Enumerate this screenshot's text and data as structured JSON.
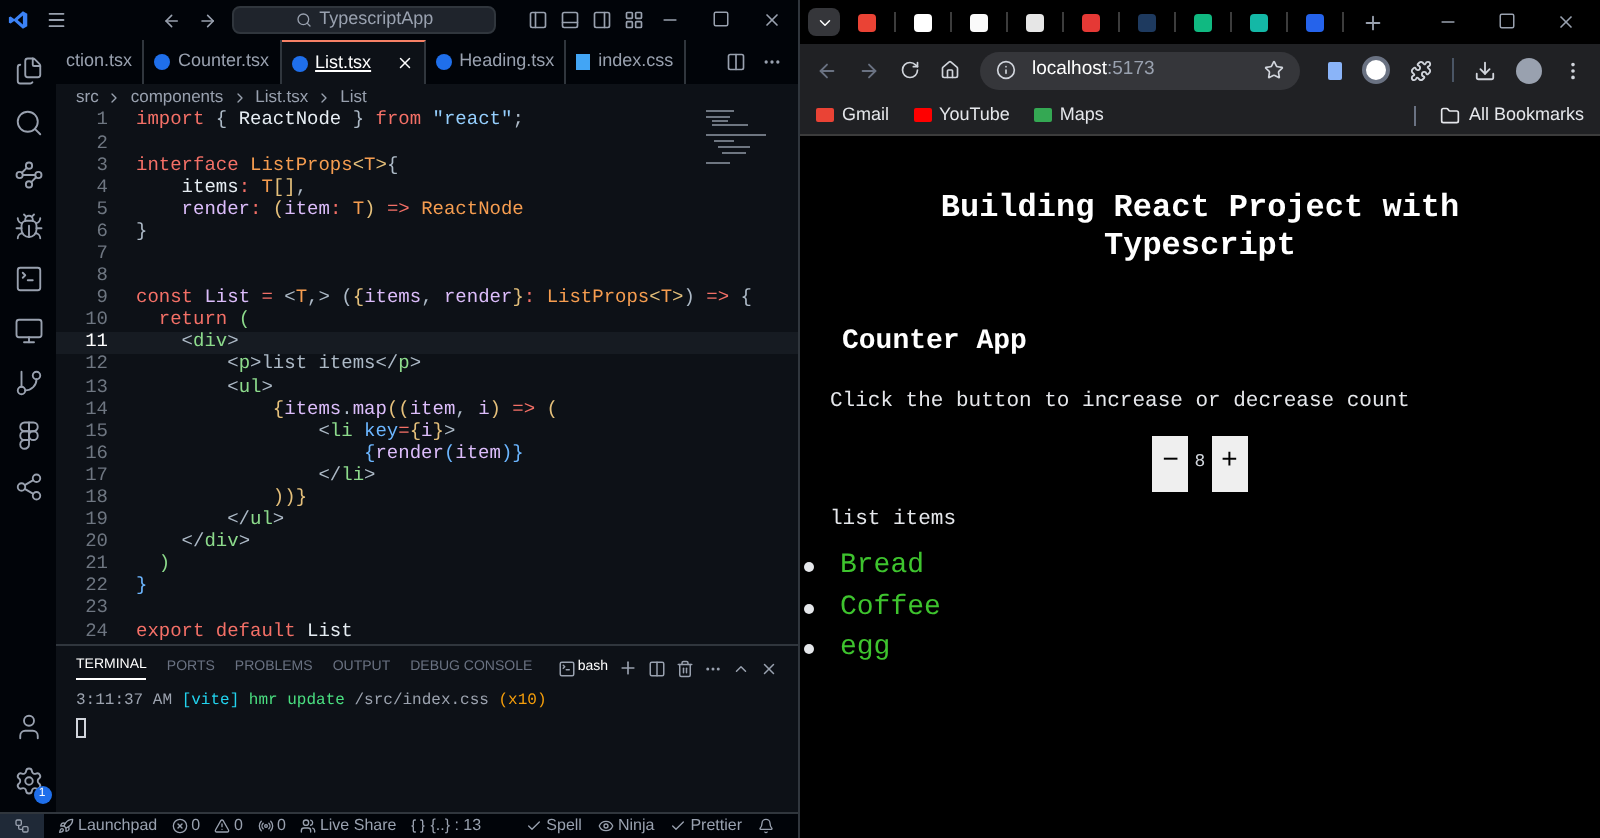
{
  "editor": {
    "title_bar": {
      "search": "TypescriptApp"
    },
    "activity_bar": [
      {
        "kind": "files"
      },
      {
        "kind": "search"
      },
      {
        "kind": "source-control"
      },
      {
        "kind": "debug"
      },
      {
        "kind": "remote"
      },
      {
        "kind": "monitor"
      },
      {
        "kind": "graph"
      },
      {
        "kind": "figma"
      },
      {
        "kind": "share"
      }
    ],
    "account": {
      "badge": "1"
    },
    "tabs": [
      {
        "label": "ction.tsx",
        "selected": false,
        "kind": "react"
      },
      {
        "label": "Counter.tsx",
        "selected": false,
        "kind": "react"
      },
      {
        "label": "List.tsx",
        "selected": true,
        "kind": "react"
      },
      {
        "label": "Heading.tsx",
        "selected": false,
        "kind": "react"
      },
      {
        "label": "index.css",
        "selected": false,
        "kind": "css"
      }
    ],
    "breadcrumb": [
      "src",
      "components",
      "List.tsx",
      "List"
    ],
    "code": [
      {
        "number": "1",
        "selected": false,
        "tokens": [
          {
            "text": "import",
            "kind": "kw"
          },
          {
            "text": " { ",
            "kind": "p"
          },
          {
            "text": "ReactNode",
            "kind": "id"
          },
          {
            "text": " } ",
            "kind": "p"
          },
          {
            "text": "from ",
            "kind": "kw"
          },
          {
            "text": "\"react\"",
            "kind": "str"
          },
          {
            "text": ";",
            "kind": "p"
          }
        ]
      },
      {
        "number": "2",
        "selected": false
      },
      {
        "number": "3",
        "selected": false,
        "tokens": [
          {
            "text": "interface ",
            "kind": "kw"
          },
          {
            "text": "ListProps",
            "kind": "type"
          },
          {
            "text": "<",
            "kind": "br"
          },
          {
            "text": "T",
            "kind": "type"
          },
          {
            "text": ">",
            "kind": "br"
          },
          {
            "text": "{",
            "kind": "p"
          }
        ]
      },
      {
        "number": "4",
        "selected": false,
        "tokens": [
          {
            "text": "    items",
            "kind": "id"
          },
          {
            "text": ": ",
            "kind": "kw"
          },
          {
            "text": "T",
            "kind": "type"
          },
          {
            "text": "[]",
            "kind": "br"
          },
          {
            "text": ",",
            "kind": "p"
          }
        ]
      },
      {
        "number": "5",
        "selected": false,
        "tokens": [
          {
            "text": "    render",
            "kind": "param"
          },
          {
            "text": ": ",
            "kind": "kw"
          },
          {
            "text": "(",
            "kind": "br"
          },
          {
            "text": "item",
            "kind": "param"
          },
          {
            "text": ": ",
            "kind": "kw"
          },
          {
            "text": "T",
            "kind": "type"
          },
          {
            "text": ")",
            "kind": "br"
          },
          {
            "text": " => ",
            "kind": "kw"
          },
          {
            "text": "ReactNode",
            "kind": "type"
          }
        ]
      },
      {
        "number": "6",
        "selected": false,
        "tokens": [
          {
            "text": "}",
            "kind": "p"
          }
        ]
      },
      {
        "number": "7",
        "selected": false
      },
      {
        "number": "8",
        "selected": false
      },
      {
        "number": "9",
        "selected": false,
        "tokens": [
          {
            "text": "const ",
            "kind": "kw"
          },
          {
            "text": "List",
            "kind": "fn"
          },
          {
            "text": " =",
            "kind": "kw"
          },
          {
            "text": " <",
            "kind": "p"
          },
          {
            "text": "T",
            "kind": "type"
          },
          {
            "text": ",> (",
            "kind": "p"
          },
          {
            "text": "{",
            "kind": "br"
          },
          {
            "text": "items",
            "kind": "param"
          },
          {
            "text": ", ",
            "kind": "p"
          },
          {
            "text": "render",
            "kind": "param"
          },
          {
            "text": "}",
            "kind": "br"
          },
          {
            "text": ": ",
            "kind": "kw"
          },
          {
            "text": "ListProps",
            "kind": "type"
          },
          {
            "text": "<",
            "kind": "br"
          },
          {
            "text": "T",
            "kind": "type"
          },
          {
            "text": ">",
            "kind": "br"
          },
          {
            "text": ")",
            "kind": "p"
          },
          {
            "text": " =>",
            "kind": "kw"
          },
          {
            "text": " {",
            "kind": "p"
          }
        ]
      },
      {
        "number": "10",
        "selected": false,
        "tokens": [
          {
            "text": "  return ",
            "kind": "kw"
          },
          {
            "text": "(",
            "kind": "tag"
          }
        ]
      },
      {
        "number": "11",
        "selected": true,
        "tokens": [
          {
            "text": "    <",
            "kind": "p"
          },
          {
            "text": "div",
            "kind": "tag"
          },
          {
            "text": ">",
            "kind": "p"
          }
        ]
      },
      {
        "number": "12",
        "selected": false,
        "tokens": [
          {
            "text": "        <",
            "kind": "p"
          },
          {
            "text": "p",
            "kind": "tag"
          },
          {
            "text": ">list items</",
            "kind": "p"
          },
          {
            "text": "p",
            "kind": "tag"
          },
          {
            "text": ">",
            "kind": "p"
          }
        ]
      },
      {
        "number": "13",
        "selected": false,
        "tokens": [
          {
            "text": "        <",
            "kind": "p"
          },
          {
            "text": "ul",
            "kind": "tag"
          },
          {
            "text": ">",
            "kind": "p"
          }
        ]
      },
      {
        "number": "14",
        "selected": false,
        "tokens": [
          {
            "text": "            {",
            "kind": "br"
          },
          {
            "text": "items",
            "kind": "param"
          },
          {
            "text": ".",
            "kind": "p"
          },
          {
            "text": "map",
            "kind": "fn"
          },
          {
            "text": "((",
            "kind": "br"
          },
          {
            "text": "item",
            "kind": "param"
          },
          {
            "text": ", ",
            "kind": "p"
          },
          {
            "text": "i",
            "kind": "param"
          },
          {
            "text": ")",
            "kind": "br"
          },
          {
            "text": " =>",
            "kind": "kw"
          },
          {
            "text": " (",
            "kind": "br"
          }
        ]
      },
      {
        "number": "15",
        "selected": false,
        "tokens": [
          {
            "text": "                <",
            "kind": "p"
          },
          {
            "text": "li",
            "kind": "tag"
          },
          {
            "text": " key",
            "kind": "attr"
          },
          {
            "text": "=",
            "kind": "kw"
          },
          {
            "text": "{",
            "kind": "br"
          },
          {
            "text": "i",
            "kind": "param"
          },
          {
            "text": "}",
            "kind": "br"
          },
          {
            "text": ">",
            "kind": "p"
          }
        ]
      },
      {
        "number": "16",
        "selected": false,
        "tokens": [
          {
            "text": "                    {",
            "kind": "attr"
          },
          {
            "text": "render",
            "kind": "param"
          },
          {
            "text": "(",
            "kind": "attr"
          },
          {
            "text": "item",
            "kind": "param"
          },
          {
            "text": ")}",
            "kind": "attr"
          }
        ]
      },
      {
        "number": "17",
        "selected": false,
        "tokens": [
          {
            "text": "                </",
            "kind": "p"
          },
          {
            "text": "li",
            "kind": "tag"
          },
          {
            "text": ">",
            "kind": "p"
          }
        ]
      },
      {
        "number": "18",
        "selected": false,
        "tokens": [
          {
            "text": "            ))}",
            "kind": "br"
          }
        ]
      },
      {
        "number": "19",
        "selected": false,
        "tokens": [
          {
            "text": "        </",
            "kind": "p"
          },
          {
            "text": "ul",
            "kind": "tag"
          },
          {
            "text": ">",
            "kind": "p"
          }
        ]
      },
      {
        "number": "20",
        "selected": false,
        "tokens": [
          {
            "text": "    </",
            "kind": "p"
          },
          {
            "text": "div",
            "kind": "tag"
          },
          {
            "text": ">",
            "kind": "p"
          }
        ]
      },
      {
        "number": "21",
        "selected": false,
        "tokens": [
          {
            "text": "  )",
            "kind": "tag"
          }
        ]
      },
      {
        "number": "22",
        "selected": false,
        "tokens": [
          {
            "text": "}",
            "kind": "attr"
          }
        ]
      },
      {
        "number": "23",
        "selected": false
      },
      {
        "number": "24",
        "selected": false,
        "tokens": [
          {
            "text": "export default ",
            "kind": "kw"
          },
          {
            "text": "List",
            "kind": "id"
          }
        ]
      }
    ],
    "panel": {
      "tabs": [
        {
          "label": "TERMINAL",
          "selected": true
        },
        {
          "label": "PORTS",
          "selected": false
        },
        {
          "label": "PROBLEMS",
          "selected": false
        },
        {
          "label": "OUTPUT",
          "selected": false
        },
        {
          "label": "DEBUG CONSOLE",
          "selected": false
        }
      ],
      "shell": "bash",
      "output": [
        {
          "text": "3:11:37 AM ",
          "kind": "time"
        },
        {
          "text": "[vite]",
          "kind": "tool"
        },
        {
          "text": " hmr update",
          "kind": "ok"
        },
        {
          "text": " /src/index.css ",
          "kind": "time"
        },
        {
          "text": "(x10)",
          "kind": "count"
        }
      ]
    },
    "status_bar": {
      "left": [
        {
          "kind": "launchpad",
          "text": "Launchpad"
        },
        {
          "kind": "errors",
          "text": "0"
        },
        {
          "kind": "warnings",
          "text": "0"
        },
        {
          "kind": "ports",
          "text": "0"
        },
        {
          "kind": "liveshare",
          "text": "Live Share"
        },
        {
          "kind": "braces",
          "text": "{..} : 13"
        }
      ],
      "right": [
        {
          "kind": "check",
          "text": "Spell"
        },
        {
          "kind": "eye",
          "text": "Ninja"
        },
        {
          "kind": "check",
          "text": "Prettier"
        }
      ]
    }
  },
  "browser": {
    "tabs": [
      {
        "color": "#ea4335"
      },
      {
        "color": "#ffffff"
      },
      {
        "color": "#fafafa"
      },
      {
        "color": "#e6e6e6"
      },
      {
        "color": "#e53935"
      },
      {
        "color": "#1e3a5f"
      },
      {
        "color": "#10b981"
      },
      {
        "color": "#14b8a6"
      },
      {
        "color": "#2563eb"
      }
    ],
    "url": {
      "host": "localhost",
      "port": ":5173"
    },
    "bookmarks": [
      {
        "label": "Gmail",
        "color": "#ea4335"
      },
      {
        "label": "YouTube",
        "color": "#ff0000"
      },
      {
        "label": "Maps",
        "color": "#34a853"
      }
    ],
    "all_bookmarks": "All Bookmarks",
    "page": {
      "title": "Building React Project with Typescript",
      "subtitle": "Counter App",
      "instruction": "Click the button to increase or decrease count",
      "decrement": "−",
      "count": "8",
      "increment": "+",
      "list_title": "list items",
      "items": [
        "Bread",
        "Coffee",
        "egg"
      ]
    }
  }
}
